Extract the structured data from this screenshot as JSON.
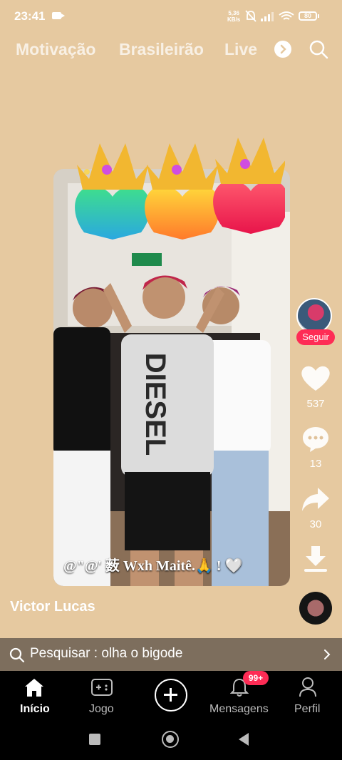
{
  "status": {
    "time": "23:41",
    "net_speed_value": "5,36",
    "net_speed_unit": "KB/s",
    "battery": "80"
  },
  "tabs": [
    "Motivação",
    "Brasileirão",
    "Live"
  ],
  "video": {
    "caption": "@\"@' 薮 Wxh Maitê.🙏 ! 🤍"
  },
  "sidebar": {
    "follow_label": "Seguir",
    "likes": "537",
    "comments": "13",
    "shares": "30"
  },
  "author": {
    "name": "Victor Lucas"
  },
  "search": {
    "text": "Pesquisar : olha o bigode"
  },
  "bottom_nav": {
    "home": "Início",
    "game": "Jogo",
    "messages": "Mensagens",
    "messages_badge": "99+",
    "profile": "Perfil"
  },
  "colors": {
    "accent": "#fe2c55",
    "background": "#e6c9a0"
  }
}
